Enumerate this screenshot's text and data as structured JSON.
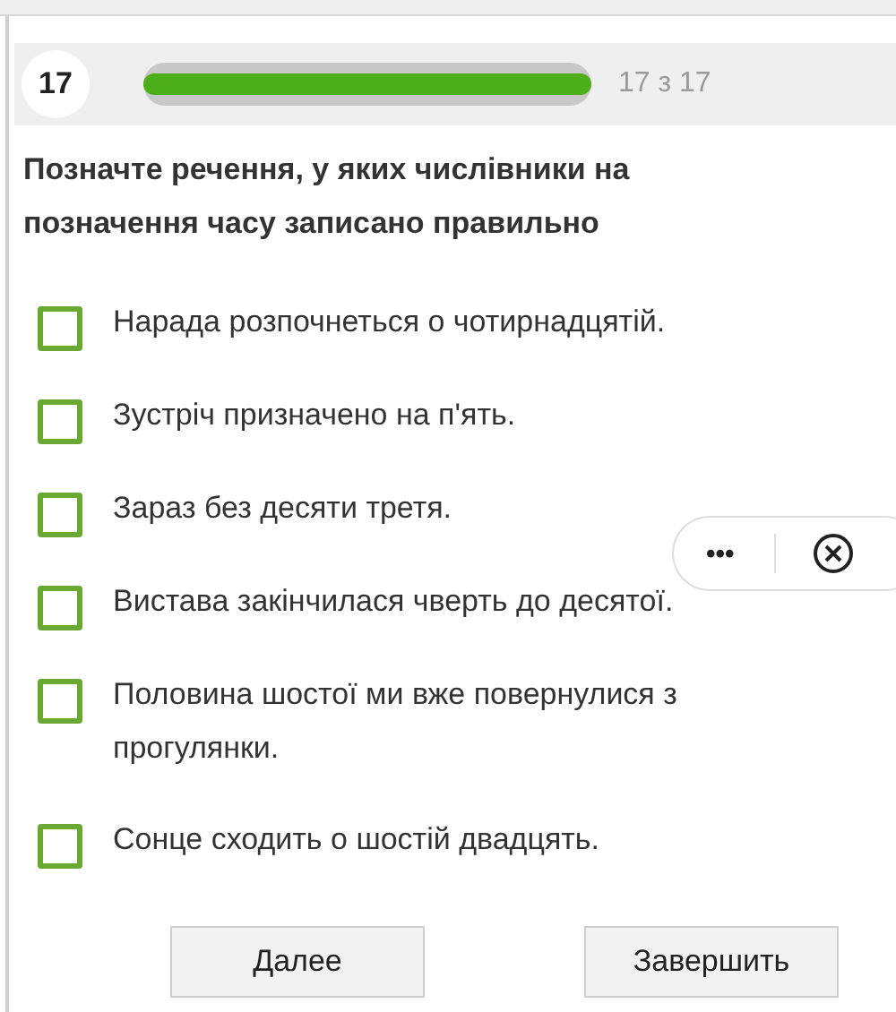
{
  "header": {
    "number": "17",
    "progress": {
      "level": 1.0
    },
    "counter": "17 з 17"
  },
  "question": "Позначте речення,  у яких числівники на позначення часу записано правильно",
  "options": [
    {
      "text": "Нарада розпочнеться о чотирнадцятій.",
      "checked": false
    },
    {
      "text": "Зустріч призначено на п'ять.",
      "checked": false
    },
    {
      "text": "Зараз без десяти третя.",
      "checked": false
    },
    {
      "text": "Вистава закінчилася чверть до десятої.",
      "checked": false
    },
    {
      "text": "Половина шостої ми вже повернулися з прогулянки.",
      "checked": false
    },
    {
      "text": "Сонце сходить о шостій двадцять.",
      "checked": false
    }
  ],
  "overlay": {
    "more": "•••"
  },
  "buttons": [
    "Далее",
    "Завершить"
  ]
}
